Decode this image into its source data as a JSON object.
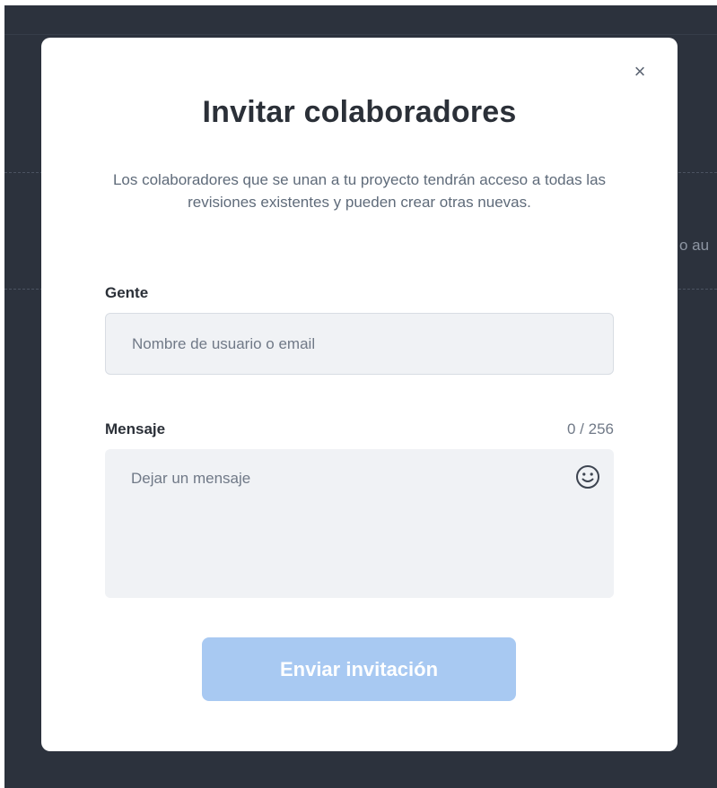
{
  "background": {
    "partial_text": "o au"
  },
  "modal": {
    "close_label": "×",
    "title": "Invitar colaboradores",
    "description": "Los colaboradores que se unan a tu proyecto tendrán acceso a todas las revisiones existentes y pueden crear otras nuevas.",
    "people_label": "Gente",
    "people_placeholder": "Nombre de usuario o email",
    "people_value": "",
    "message_label": "Mensaje",
    "message_counter": "0 / 256",
    "message_placeholder": "Dejar un mensaje",
    "message_value": "",
    "emoji_icon": "smiley-face-icon",
    "submit_label": "Enviar invitación"
  },
  "colors": {
    "backdrop": "#2c323d",
    "modal_bg": "#ffffff",
    "input_bg": "#f0f2f5",
    "button_disabled_bg": "#a8c9f2",
    "text_dark": "#2b3038",
    "text_muted": "#5f6b7a"
  }
}
